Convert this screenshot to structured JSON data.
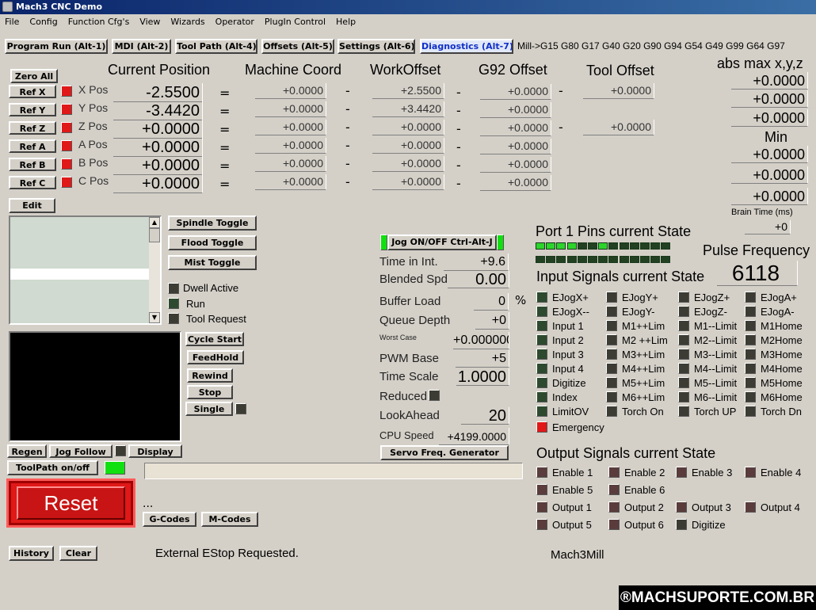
{
  "window": {
    "title": "Mach3 CNC  Demo"
  },
  "menu": [
    "File",
    "Config",
    "Function Cfg's",
    "View",
    "Wizards",
    "Operator",
    "PlugIn Control",
    "Help"
  ],
  "tabs": [
    "Program Run (Alt-1)",
    "MDI (Alt-2)",
    "Tool Path (Alt-4)",
    "Offsets (Alt-5)",
    "Settings (Alt-6)",
    "Diagnostics (Alt-7)"
  ],
  "gcode_state": "Mill->G15  G80 G17 G40 G20 G90 G94 G54 G49 G99 G64 G97",
  "headers": {
    "current_position": "Current Position",
    "machine_coord": "Machine Coord",
    "work_offset": "WorkOffset",
    "g92_offset": "G92 Offset",
    "tool_offset": "Tool Offset",
    "abs_max": "abs max x,y,z",
    "min": "Min",
    "brain_time": "Brain Time (ms)"
  },
  "zero_all": "Zero All",
  "axes": [
    {
      "ref": "Ref X",
      "name": "X Pos",
      "pos": "-2.5500",
      "machine": "+0.0000",
      "work": "+2.5500",
      "g92": "+0.0000",
      "tool": "+0.0000"
    },
    {
      "ref": "Ref Y",
      "name": "Y Pos",
      "pos": "-3.4420",
      "machine": "+0.0000",
      "work": "+3.4420",
      "g92": "+0.0000",
      "tool": ""
    },
    {
      "ref": "Ref Z",
      "name": "Z Pos",
      "pos": "+0.0000",
      "machine": "+0.0000",
      "work": "+0.0000",
      "g92": "+0.0000",
      "tool": "+0.0000"
    },
    {
      "ref": "Ref A",
      "name": "A Pos",
      "pos": "+0.0000",
      "machine": "+0.0000",
      "work": "+0.0000",
      "g92": "+0.0000",
      "tool": ""
    },
    {
      "ref": "Ref B",
      "name": "B Pos",
      "pos": "+0.0000",
      "machine": "+0.0000",
      "work": "+0.0000",
      "g92": "+0.0000",
      "tool": ""
    },
    {
      "ref": "Ref C",
      "name": "C Pos",
      "pos": "+0.0000",
      "machine": "+0.0000",
      "work": "+0.0000",
      "g92": "+0.0000",
      "tool": ""
    }
  ],
  "symbols": {
    "eq": "=",
    "dash": "-",
    "pct": "%",
    "ellipsis": "..."
  },
  "abs_max": [
    "+0.0000",
    "+0.0000",
    "+0.0000"
  ],
  "min": [
    "+0.0000",
    "+0.0000",
    "+0.0000"
  ],
  "brain_time": "+0",
  "buttons": {
    "edit": "Edit",
    "spindle": "Spindle Toggle",
    "flood": "Flood Toggle",
    "mist": "Mist Toggle",
    "cycle_start": "Cycle Start",
    "feedhold": "FeedHold",
    "rewind": "Rewind",
    "stop": "Stop",
    "single": "Single",
    "regen": "Regen",
    "jog_follow": "Jog Follow",
    "display": "Display",
    "toolpath": "ToolPath on/off",
    "reset": "Reset",
    "gcodes": "G-Codes",
    "mcodes": "M-Codes",
    "history": "History",
    "clear": "Clear",
    "jog": "Jog ON/OFF Ctrl-Alt-J",
    "servo": "Servo Freq. Generator"
  },
  "status_leds": [
    "Dwell Active",
    "Run",
    "Tool Request"
  ],
  "params": {
    "time_int": {
      "label": "Time in Int.",
      "value": "+9.6"
    },
    "blended": {
      "label": "Blended Spd",
      "value": "0.00"
    },
    "buffer": {
      "label": "Buffer Load",
      "value": "0"
    },
    "queue": {
      "label": "Queue Depth",
      "value": "+0"
    },
    "worst": {
      "label": "Worst Case",
      "value": "+0.000000"
    },
    "pwm": {
      "label": "PWM Base",
      "value": "+5"
    },
    "timescale": {
      "label": "Time Scale",
      "value": "1.0000"
    },
    "reduced": {
      "label": "Reduced"
    },
    "lookahead": {
      "label": "LookAhead",
      "value": "20"
    },
    "cpu": {
      "label": "CPU Speed",
      "value": "+4199.0000"
    }
  },
  "port": {
    "title": "Port 1 Pins current State",
    "pulse_title": "Pulse Frequency",
    "pulse_value": "6118",
    "row1": [
      1,
      1,
      1,
      1,
      0,
      0,
      1,
      0,
      0,
      0,
      0,
      0,
      0
    ],
    "row2": [
      0,
      0,
      0,
      0,
      0,
      0,
      0,
      0,
      0,
      0,
      0,
      0,
      0
    ]
  },
  "input_title": "Input Signals current State",
  "inputs": [
    [
      "EJogX+",
      "EJogY+",
      "EJogZ+",
      "EJogA+"
    ],
    [
      "EJogX--",
      "EJogY-",
      "EJogZ-",
      "EJogA-"
    ],
    [
      "Input 1",
      "M1++Lim",
      "M1--Limit",
      "M1Home"
    ],
    [
      "Input 2",
      "M2 ++Lim",
      "M2--Limit",
      "M2Home"
    ],
    [
      "Input 3",
      "M3++Lim",
      "M3--Limit",
      "M3Home"
    ],
    [
      "Input 4",
      "M4++Lim",
      "M4--Limit",
      "M4Home"
    ],
    [
      "Digitize",
      "M5++Lim",
      "M5--Limit",
      "M5Home"
    ],
    [
      "Index",
      "M6++Lim",
      "M6--Limit",
      "M6Home"
    ],
    [
      "LimitOV",
      "Torch On",
      "Torch UP",
      "Torch Dn"
    ]
  ],
  "emergency": "Emergency",
  "output_title": "Output Signals current State",
  "outputs": [
    [
      "Enable 1",
      "Enable 2",
      "Enable 3",
      "Enable 4"
    ],
    [
      "Enable 5",
      "Enable 6"
    ],
    [
      "Output 1",
      "Output 2",
      "Output 3",
      "Output 4"
    ],
    [
      "Output 5",
      "Output 6",
      "Digitize"
    ]
  ],
  "status_message": "External EStop Requested.",
  "profile": "Mach3Mill",
  "watermark": "®MACHSUPORTE.COM.BR",
  "colors": {
    "accent": "#1030c8",
    "red": "#e01818",
    "green": "#10e010"
  }
}
